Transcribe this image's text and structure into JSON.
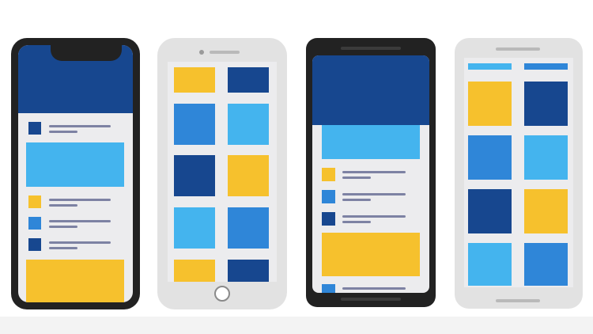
{
  "colors": {
    "navy": "#17478f",
    "royal_blue": "#2f86d8",
    "sky_blue": "#44b4ee",
    "yellow": "#f6c12d",
    "list_line": "#7d82a3",
    "screen_bg": "#ececee",
    "phone_dark": "#222222",
    "phone_light": "#e2e2e2",
    "home_button_ring": "#8a8a8a"
  },
  "phones": [
    {
      "model": "notched-phone",
      "frame": "dark",
      "layout": "feed",
      "sections": [
        "header",
        "list-item",
        "banner",
        "list-item",
        "list-item",
        "list-item",
        "banner"
      ],
      "icons": [
        "navy",
        "yellow",
        "royal_blue",
        "navy"
      ]
    },
    {
      "model": "home-button-phone",
      "frame": "light",
      "layout": "grid",
      "grid_tiles": [
        "yellow",
        "navy",
        "royal_blue",
        "sky_blue",
        "navy",
        "yellow",
        "sky_blue",
        "royal_blue",
        "yellow",
        "navy"
      ]
    },
    {
      "model": "bezel-phone",
      "frame": "dark",
      "layout": "feed",
      "sections": [
        "header",
        "banner",
        "list-item",
        "list-item",
        "list-item",
        "banner",
        "list-item"
      ],
      "icons": [
        "yellow",
        "royal_blue",
        "navy",
        "royal_blue"
      ]
    },
    {
      "model": "tall-phone",
      "frame": "light",
      "layout": "grid",
      "grid_tiles": [
        "sky_blue",
        "royal_blue",
        "yellow",
        "navy",
        "royal_blue",
        "sky_blue",
        "navy",
        "yellow",
        "sky_blue",
        "royal_blue"
      ]
    }
  ]
}
